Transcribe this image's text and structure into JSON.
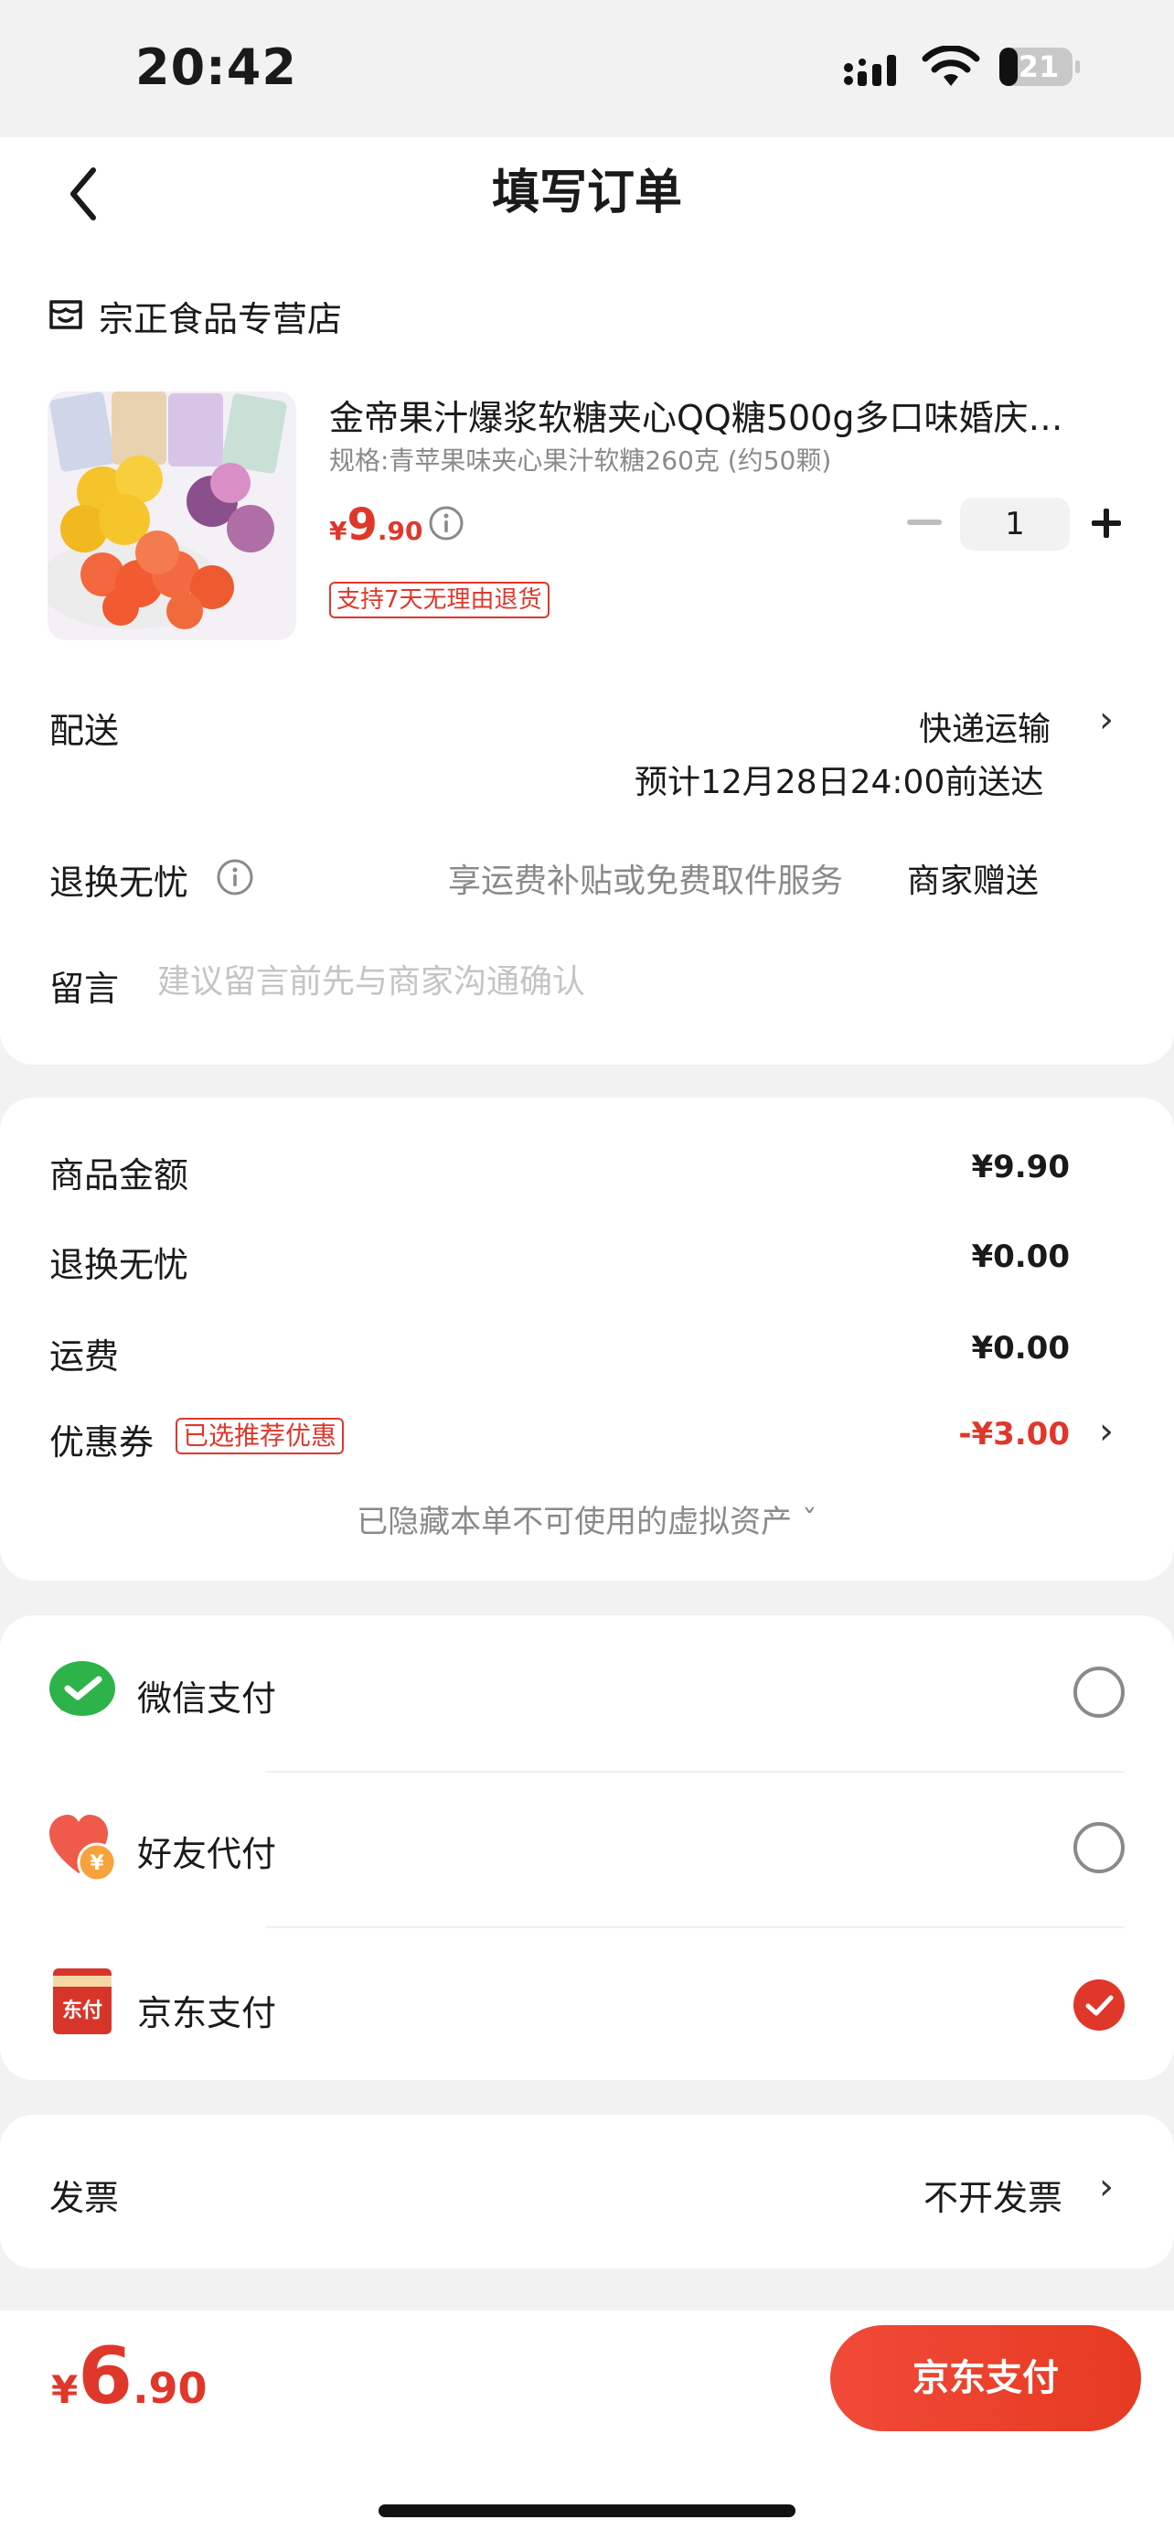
{
  "status_bar": {
    "time": "20:42",
    "battery": "21"
  },
  "header": {
    "title": "填写订单"
  },
  "store": {
    "name": "宗正食品专营店"
  },
  "product": {
    "title": "金帝果汁爆浆软糖夹心QQ糖500g多口味婚庆…",
    "spec": "规格:青苹果味夹心果汁软糖260克 (约50颗)",
    "price_currency": "¥",
    "price_int": "9",
    "price_dec": ".90",
    "quantity": "1",
    "badge": "支持7天无理由退货"
  },
  "delivery": {
    "label": "配送",
    "method": "快递运输",
    "eta": "预计12月28日24:00前送达"
  },
  "worry_free": {
    "label": "退换无忧",
    "desc": "享运费补贴或免费取件服务",
    "value": "商家赠送"
  },
  "message": {
    "label": "留言",
    "placeholder": "建议留言前先与商家沟通确认"
  },
  "amounts": {
    "goods_label": "商品金额",
    "goods_value": "¥9.90",
    "worry_label": "退换无忧",
    "worry_value": "¥0.00",
    "freight_label": "运费",
    "freight_value": "¥0.00",
    "coupon_label": "优惠券",
    "coupon_badge": "已选推荐优惠",
    "coupon_value": "-¥3.00",
    "hidden_note": "已隐藏本单不可使用的虚拟资产 ˇ"
  },
  "payment": {
    "wechat": "微信支付",
    "friend": "好友代付",
    "jd": "京东支付",
    "selected": "jd",
    "jd_icon_text": "东付"
  },
  "invoice": {
    "label": "发票",
    "value": "不开发票"
  },
  "bottom": {
    "total_currency": "¥",
    "total_int": "6",
    "total_dec": ".90",
    "pay_button": "京东支付"
  },
  "colors": {
    "accent": "#e0372b",
    "wechat": "#2db34a"
  }
}
